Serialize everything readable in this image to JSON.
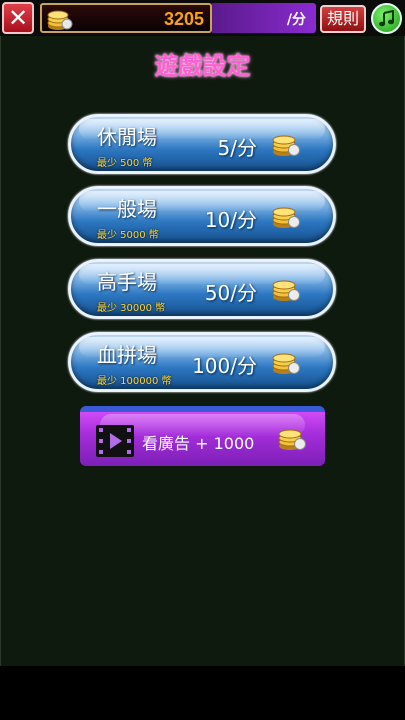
{
  "header": {
    "balance": "3205",
    "rate_label": "/分",
    "rules_label": "規則"
  },
  "title": "遊戲設定",
  "rooms": [
    {
      "name": "休閒場",
      "rate": "5/分",
      "min": "最少 500 幣"
    },
    {
      "name": "一般場",
      "rate": "10/分",
      "min": "最少 5000 幣"
    },
    {
      "name": "高手場",
      "rate": "50/分",
      "min": "最少 30000 幣"
    },
    {
      "name": "血拼場",
      "rate": "100/分",
      "min": "最少 100000 幣"
    }
  ],
  "ad": {
    "label": "看廣告 + 1000"
  },
  "icons": {
    "close": "close-icon",
    "coin": "coin-stack-icon",
    "music": "music-note-icon",
    "video": "video-clip-icon"
  },
  "colors": {
    "title": "#ff5fd2",
    "balance": "#f7a21b",
    "min_text": "#ffd83a",
    "room_blue": "#2d78c2",
    "ad_purple": "#a62edc"
  }
}
